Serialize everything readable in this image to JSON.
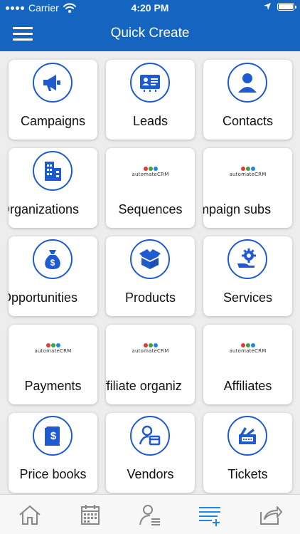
{
  "status_bar": {
    "carrier": "Carrier",
    "time": "4:20 PM"
  },
  "header": {
    "title": "Quick Create",
    "menu_icon": "hamburger-menu-icon"
  },
  "colors": {
    "header_bg": "#1565c0",
    "icon_blue": "#1e5bd1",
    "active_tab": "#1e88e5",
    "inactive_tab": "#888888"
  },
  "logo_text": "automateCRM",
  "tiles": [
    {
      "label": "Campaigns",
      "icon": "megaphone-icon"
    },
    {
      "label": "Leads",
      "icon": "id-card-icon"
    },
    {
      "label": "Contacts",
      "icon": "person-icon"
    },
    {
      "label": "Organizations",
      "icon": "building-icon"
    },
    {
      "label": "Sequences",
      "icon": "automatecrm-logo"
    },
    {
      "label": "Campaign subs",
      "icon": "automatecrm-logo"
    },
    {
      "label": "Opportunities",
      "icon": "money-bag-icon"
    },
    {
      "label": "Products",
      "icon": "box-icon"
    },
    {
      "label": "Services",
      "icon": "gear-hand-icon"
    },
    {
      "label": "Payments",
      "icon": "automatecrm-logo"
    },
    {
      "label": "Affiliate organiz",
      "icon": "automatecrm-logo"
    },
    {
      "label": "Affiliates",
      "icon": "automatecrm-logo"
    },
    {
      "label": "Price books",
      "icon": "price-book-icon"
    },
    {
      "label": "Vendors",
      "icon": "vendor-icon"
    },
    {
      "label": "Tickets",
      "icon": "ticket-icon"
    }
  ],
  "tabs": [
    {
      "icon": "home-icon",
      "active": false
    },
    {
      "icon": "calendar-icon",
      "active": false
    },
    {
      "icon": "contacts-list-icon",
      "active": false
    },
    {
      "icon": "quick-create-icon",
      "active": true
    },
    {
      "icon": "share-icon",
      "active": false
    }
  ]
}
